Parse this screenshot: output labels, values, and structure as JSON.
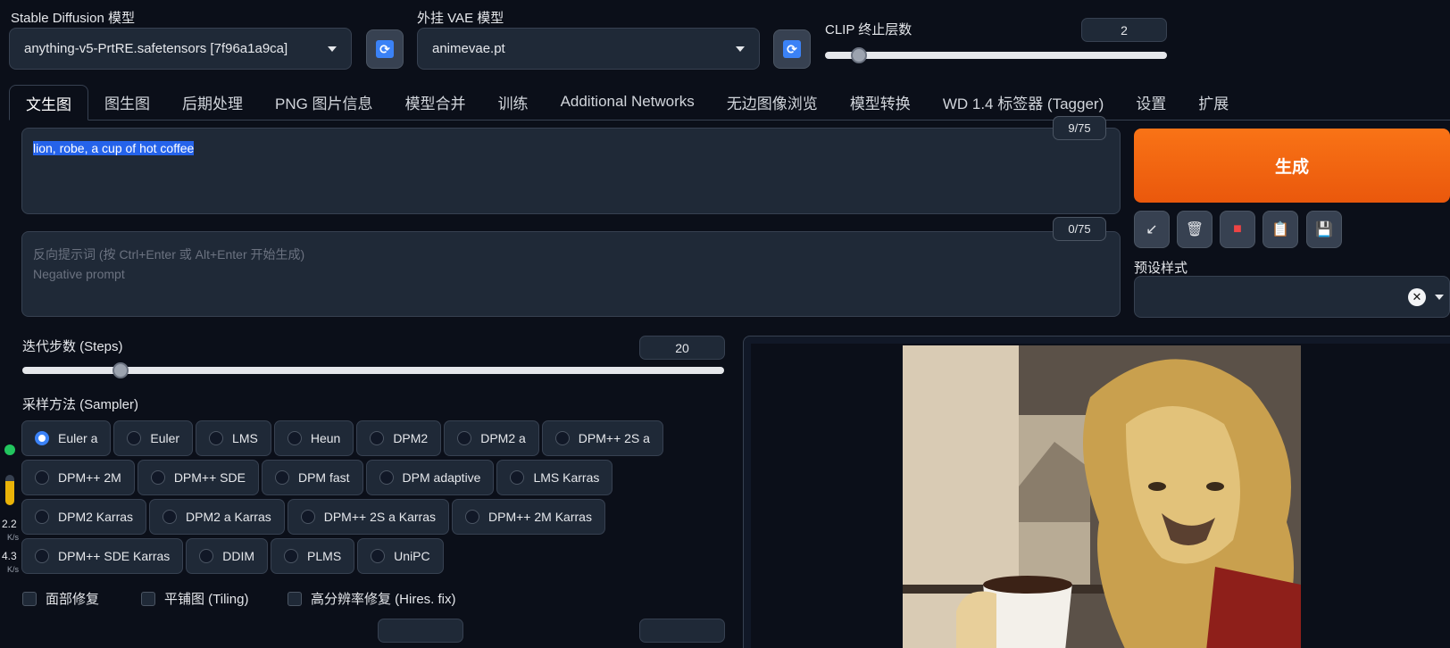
{
  "top": {
    "sd_model_label": "Stable Diffusion 模型",
    "sd_model_value": "anything-v5-PrtRE.safetensors [7f96a1a9ca]",
    "vae_label": "外挂 VAE 模型",
    "vae_value": "animevae.pt",
    "clip_label": "CLIP 终止层数",
    "clip_value": "2",
    "clip_fraction": 0.1
  },
  "tabs": [
    {
      "label": "文生图"
    },
    {
      "label": "图生图"
    },
    {
      "label": "后期处理"
    },
    {
      "label": "PNG 图片信息"
    },
    {
      "label": "模型合并"
    },
    {
      "label": "训练"
    },
    {
      "label": "Additional Networks"
    },
    {
      "label": "无边图像浏览"
    },
    {
      "label": "模型转换"
    },
    {
      "label": "WD 1.4 标签器 (Tagger)"
    },
    {
      "label": "设置"
    },
    {
      "label": "扩展"
    }
  ],
  "prompt": {
    "text": "lion, robe, a cup of hot coffee",
    "counter": "9/75"
  },
  "negative": {
    "placeholder_line1": "反向提示词 (按 Ctrl+Enter 或 Alt+Enter 开始生成)",
    "placeholder_line2": "Negative prompt",
    "counter": "0/75"
  },
  "actions": {
    "generate_label": "生成",
    "tool_icons": [
      "arrow-icon",
      "trash-icon",
      "flag-icon",
      "clipboard-icon",
      "save-icon"
    ],
    "styles_label": "预设样式"
  },
  "steps": {
    "label": "迭代步数 (Steps)",
    "value": "20",
    "fraction": 0.14
  },
  "sampler": {
    "label": "采样方法 (Sampler)",
    "rows": [
      [
        "Euler a",
        "Euler",
        "LMS",
        "Heun",
        "DPM2",
        "DPM2 a",
        "DPM++ 2S a"
      ],
      [
        "DPM++ 2M",
        "DPM++ SDE",
        "DPM fast",
        "DPM adaptive",
        "LMS Karras"
      ],
      [
        "DPM2 Karras",
        "DPM2 a Karras",
        "DPM++ 2S a Karras",
        "DPM++ 2M Karras"
      ],
      [
        "DPM++ SDE Karras",
        "DDIM",
        "PLMS",
        "UniPC"
      ]
    ],
    "selected": "Euler a"
  },
  "options": {
    "face_restore": "面部修复",
    "tiling": "平铺图 (Tiling)",
    "hires": "高分辨率修复 (Hires. fix)"
  },
  "sidebar_stats": {
    "v1": "2.2",
    "u1": "K/s",
    "v2": "4.3",
    "u2": "K/s"
  }
}
